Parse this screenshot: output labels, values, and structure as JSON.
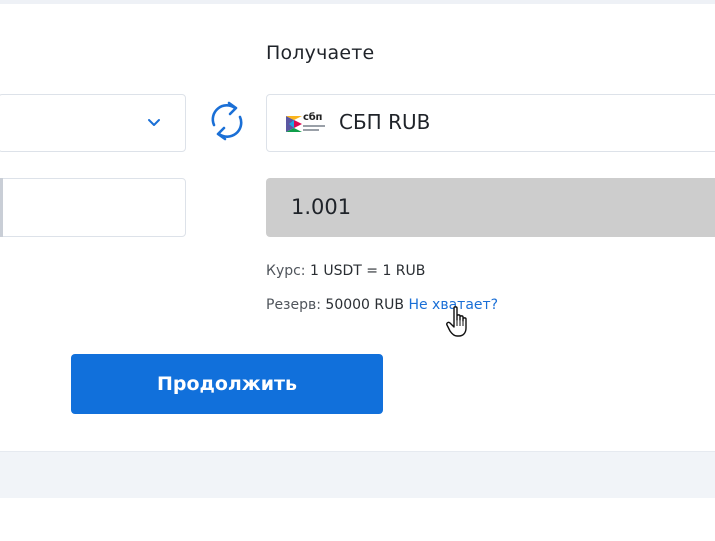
{
  "receive": {
    "heading": "Получаете",
    "currency": "СБП RUB",
    "logo_text": "сбп",
    "amount": "1.001"
  },
  "info": {
    "rate_label": "Курс:",
    "rate_value": "1 USDT = 1 RUB",
    "reserve_label": "Резерв:",
    "reserve_value": "50000 RUB",
    "reserve_link": "Не хватает?"
  },
  "actions": {
    "continue_label": "Продолжить"
  },
  "icons": {
    "swap": "swap-arrows-icon",
    "chevron": "chevron-down-icon",
    "cursor": "hand-pointer-icon"
  },
  "colors": {
    "accent": "#1170db",
    "link": "#1a6fd6",
    "amount_bg": "#cdcdcd"
  }
}
